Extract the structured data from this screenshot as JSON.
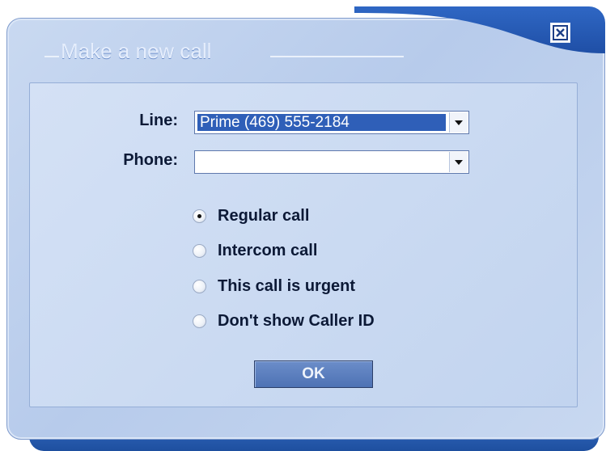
{
  "dialog": {
    "title": "Make a new call",
    "close_icon": "close-icon"
  },
  "form": {
    "line_label": "Line:",
    "line_value": "Prime (469) 555-2184",
    "phone_label": "Phone:",
    "phone_value": ""
  },
  "options": [
    {
      "label": "Regular call",
      "checked": true
    },
    {
      "label": "Intercom call",
      "checked": false
    },
    {
      "label": "This call is urgent",
      "checked": false
    },
    {
      "label": "Don't show Caller ID",
      "checked": false
    }
  ],
  "buttons": {
    "ok_label": "OK"
  },
  "colors": {
    "title_blue": "#2f67c4",
    "panel": "#c2d4ef",
    "selection": "#2f5fb8"
  }
}
